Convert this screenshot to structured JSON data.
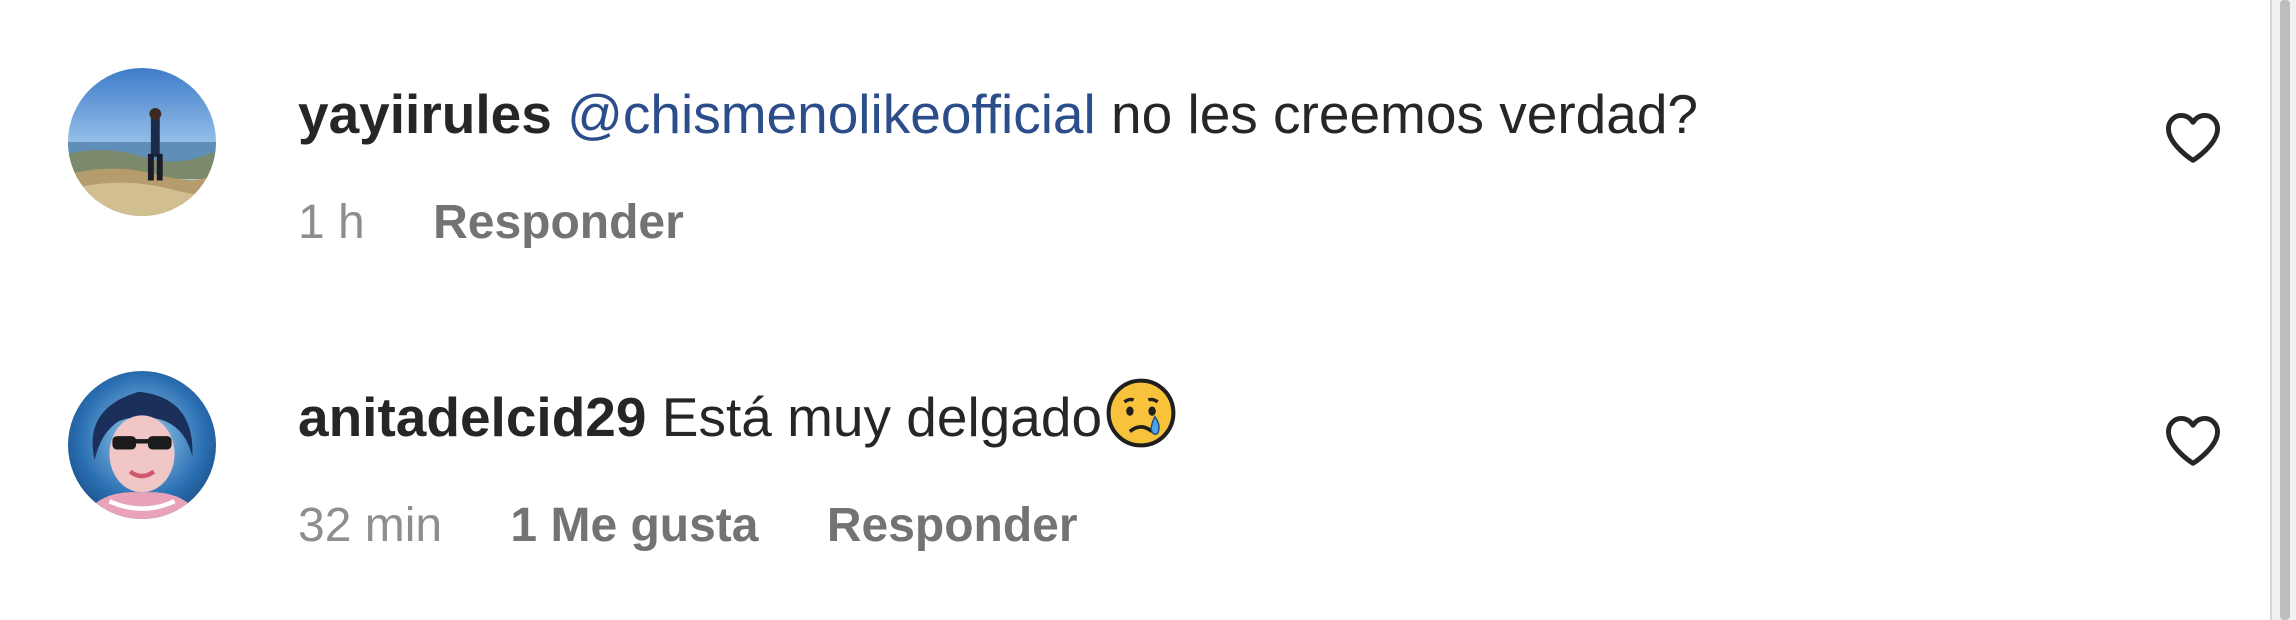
{
  "comments": [
    {
      "username": "yayiirules",
      "mention": "@chismenolikeofficial",
      "text": "no les creemos verdad?",
      "time": "1 h",
      "likes": "",
      "reply_label": "Responder",
      "avatar_icon": "landscape-photo-avatar",
      "like_icon": "heart-outline-icon"
    },
    {
      "username": "anitadelcid29",
      "mention": "",
      "text": "Está muy delgado",
      "emoji": "crying-face-emoji",
      "time": "32 min",
      "likes": "1 Me gusta",
      "reply_label": "Responder",
      "avatar_icon": "portrait-photo-avatar",
      "like_icon": "heart-outline-icon"
    }
  ],
  "colors": {
    "username": "#262626",
    "mention": "#2b4d8a",
    "meta": "#8e8e8e",
    "background": "#ffffff"
  }
}
